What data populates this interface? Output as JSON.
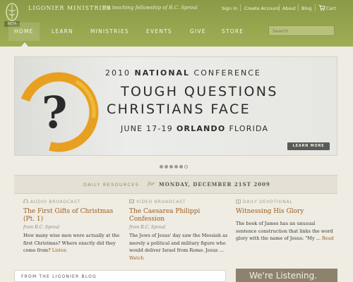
{
  "header": {
    "brand": "LIGONIER MINISTRIES",
    "tagline": "the teaching fellowship of R.C. Sproul",
    "badge": "BETA",
    "logo_icon": "ligonier-leaf-logo",
    "util_links": [
      "Sign In",
      "Create Account",
      "About",
      "Blog",
      "Cart"
    ],
    "cart_icon": "cart-icon"
  },
  "nav": {
    "items": [
      "HOME",
      "LEARN",
      "MINISTRIES",
      "EVENTS",
      "GIVE",
      "STORE"
    ],
    "active": "HOME"
  },
  "search": {
    "placeholder": "Search"
  },
  "banner": {
    "year": "2010",
    "headline_bold": "NATIONAL",
    "headline_rest": "CONFERENCE",
    "line2": "TOUGH QUESTIONS",
    "line3": "CHRISTIANS FACE",
    "dates": "JUNE 17-19",
    "city": "ORLANDO",
    "state": "FLORIDA",
    "cta": "LEARN MORE",
    "slide_count": 6,
    "active_slide": 6
  },
  "daily": {
    "label": "DAILY RESOURCES",
    "for": "for",
    "date": "MONDAY, DECEMBER 21ST 2009",
    "columns": [
      {
        "type": "AUDIO BROADCAST",
        "icon": "headphones-icon",
        "title": "The First Gifts of Christmas (Pt. 1)",
        "author": "from R.C. Sproul",
        "body": "How many wise men were actually at the first Christmas? Where exactly did they come from?",
        "link": "Listen"
      },
      {
        "type": "VIDEO BROADCAST",
        "icon": "video-icon",
        "title": "The Caesarea Philippi Confession",
        "author": "from R.C. Sproul",
        "body": "The Jews of Jesus' day saw the Messiah as merely a political and military figure who would deliver Israel from Rome. Jesus ...",
        "link": "Watch"
      },
      {
        "type": "DAILY DEVOTIONAL",
        "icon": "book-icon",
        "title": "Witnessing His Glory",
        "author": "",
        "body": "The book of James has an unusual sentence construction that links the word glory with the name of Jesus: \"My ...",
        "link": "Read"
      }
    ]
  },
  "blog": {
    "heading": "FROM THE LIGONIER BLOG"
  },
  "promo": {
    "text": "We're Listening."
  },
  "colors": {
    "header_green": "#9aa950",
    "accent_brown": "#9a5c1c",
    "label_tan": "#a3855a",
    "banner_orange": "#e8a020"
  }
}
